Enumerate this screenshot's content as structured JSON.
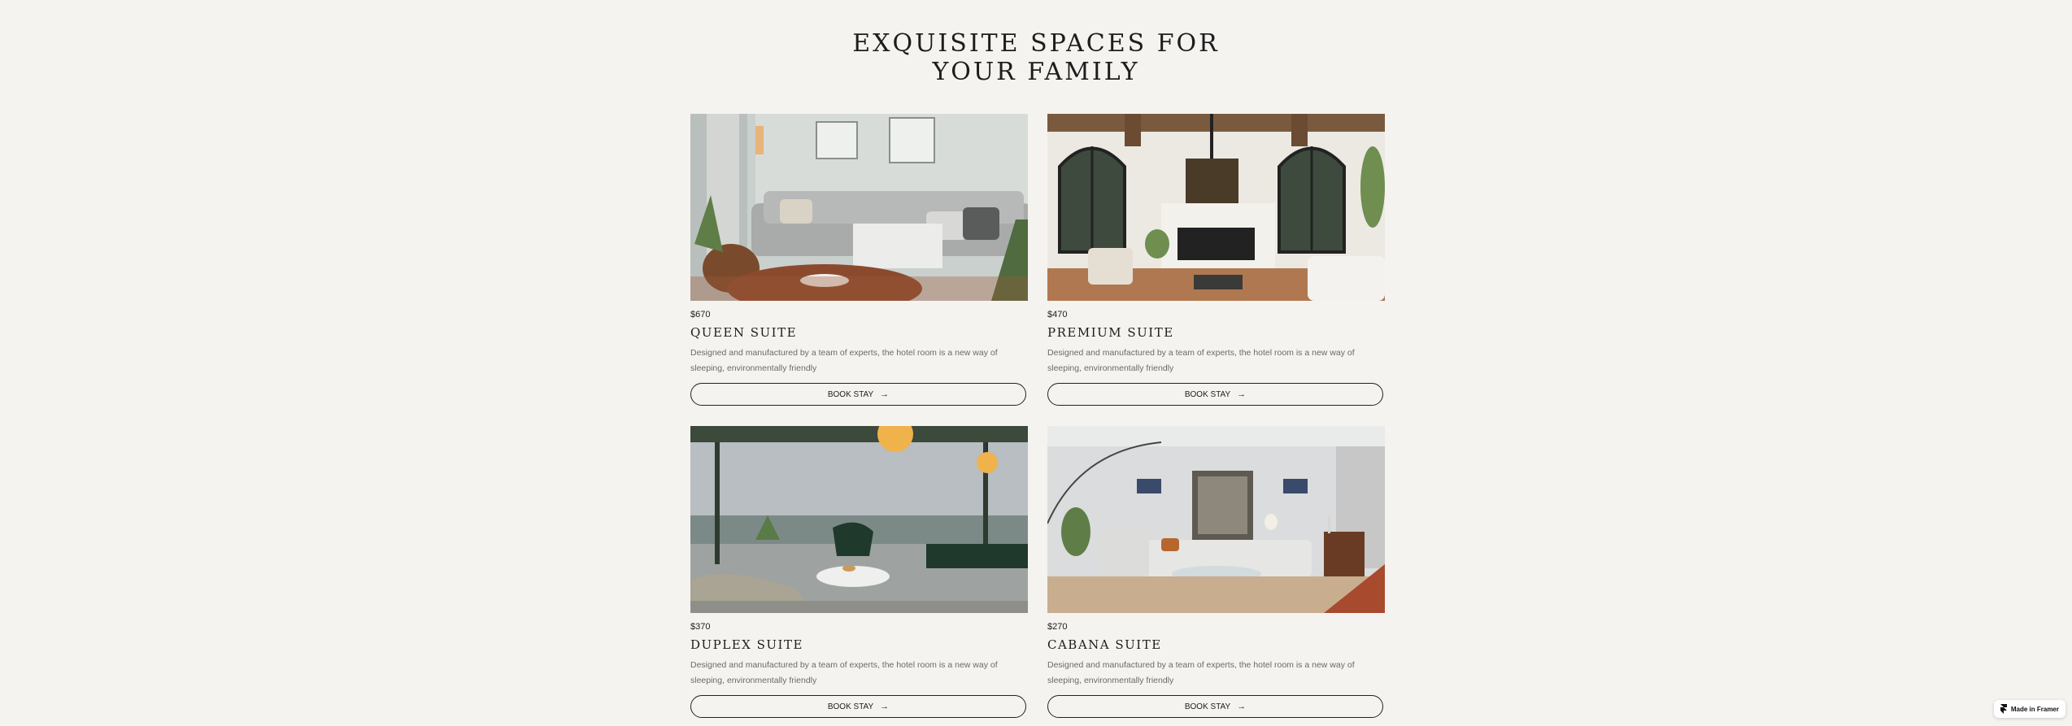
{
  "section": {
    "title_line1": "EXQUISITE SPACES FOR",
    "title_line2": "YOUR FAMILY"
  },
  "rooms": [
    {
      "price": "$670",
      "name": "QUEEN SUITE",
      "description": "Designed and manufactured by a team of experts, the hotel room is a new way of sleeping, environmentally friendly",
      "button_label": "BOOK STAY"
    },
    {
      "price": "$470",
      "name": "PREMIUM SUITE",
      "description": "Designed and manufactured by a team of experts, the hotel room is a new way of sleeping, environmentally friendly",
      "button_label": "BOOK STAY"
    },
    {
      "price": "$370",
      "name": "DUPLEX SUITE",
      "description": "Designed and manufactured by a team of experts, the hotel room is a new way of sleeping, environmentally friendly",
      "button_label": "BOOK STAY"
    },
    {
      "price": "$270",
      "name": "CABANA SUITE",
      "description": "Designed and manufactured by a team of experts, the hotel room is a new way of sleeping, environmentally friendly",
      "button_label": "BOOK STAY"
    }
  ],
  "badge": {
    "label": "Made in Framer",
    "icon": "framer-logo-icon"
  },
  "colors": {
    "background": "#f5f3ef",
    "text": "#1d1d1d",
    "muted_text": "#6a6a6a"
  }
}
